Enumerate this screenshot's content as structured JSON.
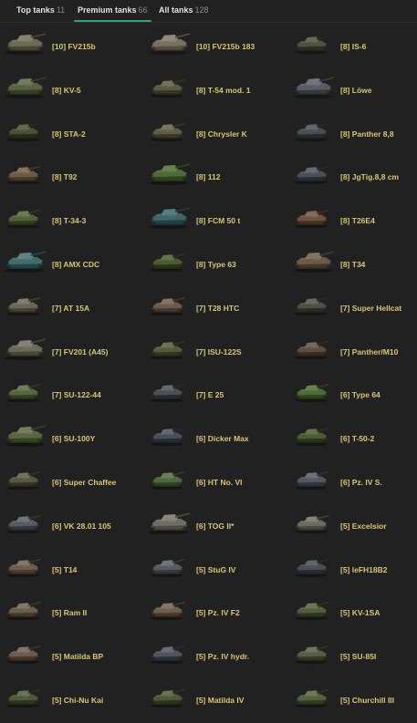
{
  "tabs": [
    {
      "label": "Top tanks",
      "count": "11",
      "active": false
    },
    {
      "label": "Premium tanks",
      "count": "66",
      "active": true
    },
    {
      "label": "All tanks",
      "count": "128",
      "active": false
    }
  ],
  "colors": {
    "background": "#212121",
    "tank_name": "#d8c676",
    "tab_active_underline": "#2fa36b"
  },
  "tanks": [
    {
      "name": "[10] FV215b",
      "camo": "#6b6a56",
      "big": true
    },
    {
      "name": "[10] FV215b 183",
      "camo": "#7a6f60",
      "big": true
    },
    {
      "name": "[8] IS-6",
      "camo": "#4e5040",
      "big": false
    },
    {
      "name": "[8] KV-5",
      "camo": "#5a6144",
      "big": true
    },
    {
      "name": "[8] T-54 mod. 1",
      "camo": "#5c5a45",
      "big": false
    },
    {
      "name": "[8] Löwe",
      "camo": "#585c64",
      "big": true
    },
    {
      "name": "[8] STA-2",
      "camo": "#4a5035",
      "big": false
    },
    {
      "name": "[8] Chrysler K",
      "camo": "#5f5d48",
      "big": false
    },
    {
      "name": "[8] Panther 8,8",
      "camo": "#4a4d54",
      "big": false
    },
    {
      "name": "[8] T92",
      "camo": "#6e5b49",
      "big": false
    },
    {
      "name": "[8] 112",
      "camo": "#4f6a3a",
      "big": true
    },
    {
      "name": "[8] JgTig.8,8 cm",
      "camo": "#4d5058",
      "big": false
    },
    {
      "name": "[8] T-34-3",
      "camo": "#52633b",
      "big": false
    },
    {
      "name": "[8] FCM 50 t",
      "camo": "#3f6468",
      "big": true
    },
    {
      "name": "[8] T26E4",
      "camo": "#6c5344",
      "big": false
    },
    {
      "name": "[8] AMX CDC",
      "camo": "#456a6c",
      "big": true
    },
    {
      "name": "[8] Type 63",
      "camo": "#4c5a33",
      "big": false
    },
    {
      "name": "[8] T34",
      "camo": "#6b5a4a",
      "big": true
    },
    {
      "name": "[7] AT 15A",
      "camo": "#6b6458",
      "big": false
    },
    {
      "name": "[7] T28 HTC",
      "camo": "#6d5a4c",
      "big": false
    },
    {
      "name": "[7] Super Hellcat",
      "camo": "#4e5048",
      "big": false
    },
    {
      "name": "[7] FV201 (A45)",
      "camo": "#6a6a5a",
      "big": true
    },
    {
      "name": "[7] ISU-122S",
      "camo": "#555a3e",
      "big": false
    },
    {
      "name": "[7] Panther/M10",
      "camo": "#5c4e42",
      "big": false
    },
    {
      "name": "[7] SU-122-44",
      "camo": "#56653f",
      "big": false
    },
    {
      "name": "[7] E 25",
      "camo": "#4c4f55",
      "big": false
    },
    {
      "name": "[6] Type 64",
      "camo": "#4f6a3a",
      "big": false
    },
    {
      "name": "[6] SU-100Y",
      "camo": "#5a6642",
      "big": true
    },
    {
      "name": "[6] Dicker Max",
      "camo": "#4a4e56",
      "big": false
    },
    {
      "name": "[6] T-50-2",
      "camo": "#4e5a36",
      "big": false
    },
    {
      "name": "[6] Super Chaffee",
      "camo": "#5a5644",
      "big": false
    },
    {
      "name": "[6] HT No. VI",
      "camo": "#4f6640",
      "big": false
    },
    {
      "name": "[6] Pz. IV S.",
      "camo": "#555860",
      "big": false
    },
    {
      "name": "[6] VK 28.01 105",
      "camo": "#565a62",
      "big": false
    },
    {
      "name": "[6] TOG II*",
      "camo": "#6f6e64",
      "big": true
    },
    {
      "name": "[5] Excelsior",
      "camo": "#6a6a60",
      "big": false
    },
    {
      "name": "[5] T14",
      "camo": "#6a5d4d",
      "big": false
    },
    {
      "name": "[5] StuG IV",
      "camo": "#585b62",
      "big": false
    },
    {
      "name": "[5] leFH18B2",
      "camo": "#4a4e55",
      "big": false
    },
    {
      "name": "[5] Ram II",
      "camo": "#675e4c",
      "big": false
    },
    {
      "name": "[5] Pz. IV F2",
      "camo": "#6a5f4e",
      "big": false
    },
    {
      "name": "[5] KV-1SA",
      "camo": "#545c40",
      "big": false
    },
    {
      "name": "[5] Matilda BP",
      "camo": "#6a5a50",
      "big": false
    },
    {
      "name": "[5] Pz. IV hydr.",
      "camo": "#50545c",
      "big": false
    },
    {
      "name": "[5] SU-85I",
      "camo": "#565c45",
      "big": false
    },
    {
      "name": "[5] Chi-Nu Kai",
      "camo": "#4f5a3c",
      "big": false
    },
    {
      "name": "[5] Matilda IV",
      "camo": "#4e5a3a",
      "big": false
    },
    {
      "name": "[5] Churchill III",
      "camo": "#55603f",
      "big": false
    }
  ]
}
